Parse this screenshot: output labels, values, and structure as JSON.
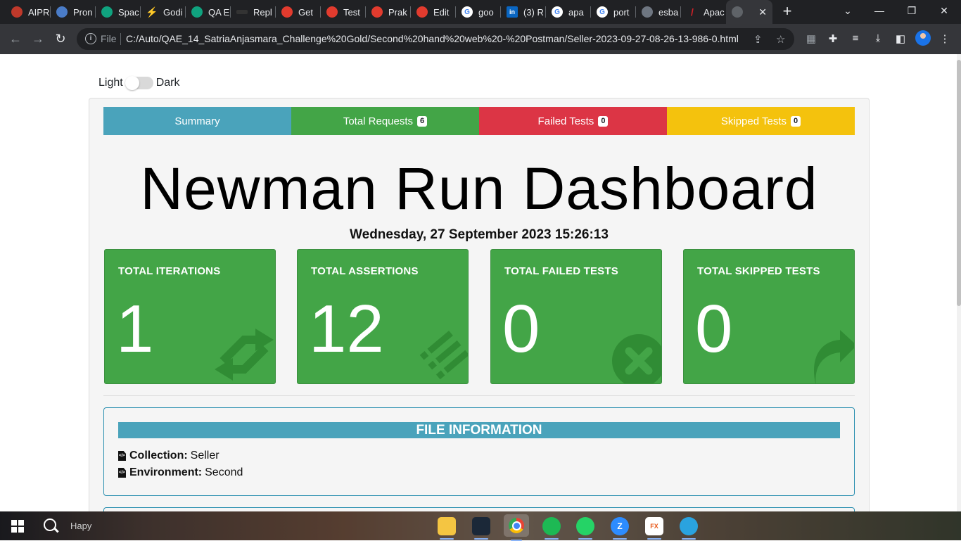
{
  "browser": {
    "tabs": [
      {
        "label": "AIPR",
        "color": "#c0392b"
      },
      {
        "label": "Pron",
        "color": "#4a7cc8"
      },
      {
        "label": "Spac",
        "color": "#10a37f"
      },
      {
        "label": "Godi",
        "color": "#f4b400"
      },
      {
        "label": "QA E",
        "color": "#10a37f"
      },
      {
        "label": "Repl",
        "color": "#333333"
      },
      {
        "label": "Get",
        "color": "#e23b2e"
      },
      {
        "label": "Test",
        "color": "#e23b2e"
      },
      {
        "label": "Prak",
        "color": "#e23b2e"
      },
      {
        "label": "Edit",
        "color": "#e23b2e"
      },
      {
        "label": "goo",
        "color": "#ffffff"
      },
      {
        "label": "(3) R",
        "color": "#0a66c2"
      },
      {
        "label": "apa",
        "color": "#ffffff"
      },
      {
        "label": "port",
        "color": "#ffffff"
      },
      {
        "label": "esba",
        "color": "#24292e"
      },
      {
        "label": "Apac",
        "color": "#d22128"
      },
      {
        "label": "",
        "color": "#5f6368"
      }
    ],
    "file_label": "File",
    "url": "C:/Auto/QAE_14_SatriaAnjasmara_Challenge%20Gold/Second%20hand%20web%20-%20Postman/Seller-2023-09-27-08-26-13-986-0.html"
  },
  "theme": {
    "light_label": "Light",
    "dark_label": "Dark"
  },
  "nav": {
    "summary": {
      "label": "Summary",
      "color": "#4aa3bb"
    },
    "total_requests": {
      "label": "Total Requests",
      "count": "6",
      "color": "#43a547"
    },
    "failed_tests": {
      "label": "Failed Tests",
      "count": "0",
      "color": "#dc3545"
    },
    "skipped_tests": {
      "label": "Skipped Tests",
      "count": "0",
      "color": "#f4c20d"
    }
  },
  "dashboard": {
    "title": "Newman Run Dashboard",
    "date": "Wednesday, 27 September 2023 15:26:13"
  },
  "cards": [
    {
      "title": "TOTAL ITERATIONS",
      "value": "1",
      "icon": "sync-icon"
    },
    {
      "title": "TOTAL ASSERTIONS",
      "value": "12",
      "icon": "list-icon"
    },
    {
      "title": "TOTAL FAILED TESTS",
      "value": "0",
      "icon": "times-circle-icon"
    },
    {
      "title": "TOTAL SKIPPED TESTS",
      "value": "0",
      "icon": "share-arrow-icon"
    }
  ],
  "file_info": {
    "heading": "FILE INFORMATION",
    "collection_label": "Collection:",
    "collection_value": "Seller",
    "environment_label": "Environment:",
    "environment_value": "Second"
  },
  "taskbar": {
    "search_text": "Hapy",
    "apps": [
      "file-explorer-icon",
      "steam-icon",
      "chrome-icon",
      "spotify-icon",
      "whatsapp-icon",
      "zoom-icon",
      "dailyfx-icon",
      "telegram-icon"
    ]
  }
}
